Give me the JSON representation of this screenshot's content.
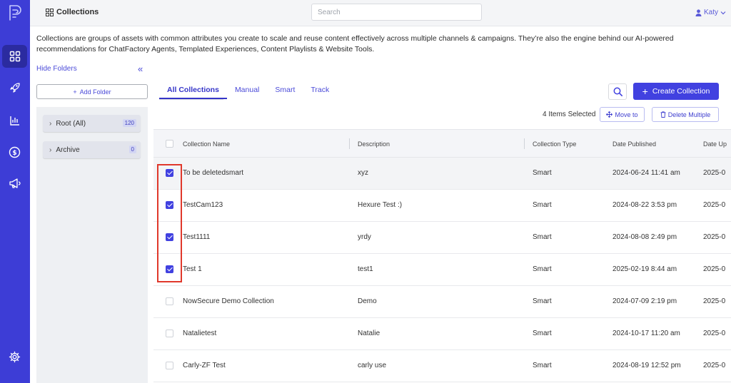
{
  "colors": {
    "accent": "#4141e0",
    "rail": "#3d3dd6",
    "highlight": "#e0382b"
  },
  "rail": {
    "items": [
      {
        "name": "dashboard-icon",
        "active": true
      },
      {
        "name": "rocket-icon",
        "active": false
      },
      {
        "name": "analytics-icon",
        "active": false
      },
      {
        "name": "dollar-icon",
        "active": false
      },
      {
        "name": "megaphone-icon",
        "active": false
      },
      {
        "name": "settings-icon",
        "active": false
      }
    ]
  },
  "header": {
    "title": "Collections",
    "search_placeholder": "Search",
    "user_name": "Katy"
  },
  "intro": "Collections are groups of assets with common attributes you create to scale and reuse content effectively across multiple channels & campaigns. They’re also the engine behind our AI-powered recommendations for ChatFactory Agents, Templated Experiences, Content Playlists & Website Tools.",
  "sidebar": {
    "hide_label": "Hide Folders",
    "collapse_glyph": "«",
    "add_folder_label": "Add Folder",
    "folders": [
      {
        "label": "Root (All)",
        "count": "120"
      },
      {
        "label": "Archive",
        "count": "0"
      }
    ]
  },
  "tabs": [
    "All Collections",
    "Manual",
    "Smart",
    "Track"
  ],
  "actions": {
    "create_label": "Create Collection",
    "selected_text": "4 Items Selected",
    "move_label": "Move to",
    "delete_label": "Delete Multiple"
  },
  "table": {
    "columns": [
      "Collection Name",
      "Description",
      "Collection Type",
      "Date Published",
      "Date Up"
    ],
    "rows": [
      {
        "name": "To be deletedsmart",
        "description": "xyz",
        "type": "Smart",
        "published": "2024-06-24 11:41 am",
        "updated": "2025-0",
        "checked": true
      },
      {
        "name": "TestCam123",
        "description": "Hexure Test :)",
        "type": "Smart",
        "published": "2024-08-22 3:53 pm",
        "updated": "2025-0",
        "checked": true
      },
      {
        "name": "Test1111",
        "description": "yrdy",
        "type": "Smart",
        "published": "2024-08-08 2:49 pm",
        "updated": "2025-0",
        "checked": true
      },
      {
        "name": "Test 1",
        "description": "test1",
        "type": "Smart",
        "published": "2025-02-19 8:44 am",
        "updated": "2025-0",
        "checked": true
      },
      {
        "name": "NowSecure Demo Collection",
        "description": "Demo",
        "type": "Smart",
        "published": "2024-07-09 2:19 pm",
        "updated": "2025-0",
        "checked": false
      },
      {
        "name": "Natalietest",
        "description": "Natalie",
        "type": "Smart",
        "published": "2024-10-17 11:20 am",
        "updated": "2025-0",
        "checked": false
      },
      {
        "name": "Carly-ZF Test",
        "description": "carly use",
        "type": "Smart",
        "published": "2024-08-19 12:52 pm",
        "updated": "2025-0",
        "checked": false
      }
    ]
  }
}
